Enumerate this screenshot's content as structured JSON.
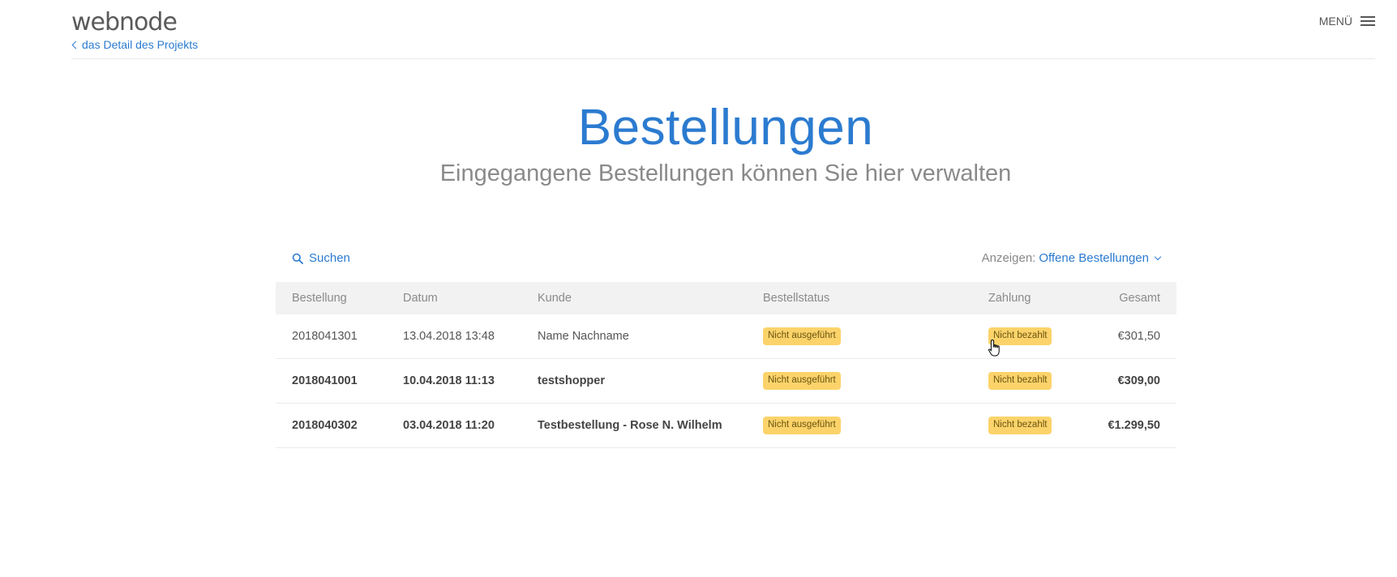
{
  "header": {
    "logo": "webnode",
    "back_link": "das Detail des Projekts",
    "menu_label": "MENÜ"
  },
  "page": {
    "title": "Bestellungen",
    "subtitle": "Eingegangene Bestellungen können Sie hier verwalten"
  },
  "toolbar": {
    "search_label": "Suchen",
    "filter_label": "Anzeigen:",
    "filter_value": "Offene Bestellungen"
  },
  "table": {
    "columns": [
      "Bestellung",
      "Datum",
      "Kunde",
      "Bestellstatus",
      "Zahlung",
      "Gesamt"
    ],
    "rows": [
      {
        "order": "2018041301",
        "date": "13.04.2018 13:48",
        "customer": "Name Nachname",
        "status": "Nicht ausgeführt",
        "payment": "Nicht bezahlt",
        "total": "€301,50"
      },
      {
        "order": "2018041001",
        "date": "10.04.2018 11:13",
        "customer": "testshopper",
        "status": "Nicht ausgeführt",
        "payment": "Nicht bezahlt",
        "total": "€309,00"
      },
      {
        "order": "2018040302",
        "date": "03.04.2018 11:20",
        "customer": "Testbestellung - Rose N. Wilhelm",
        "status": "Nicht ausgeführt",
        "payment": "Nicht bezahlt",
        "total": "€1.299,50"
      }
    ]
  },
  "icons": {
    "search": "search-icon",
    "menu": "hamburger-icon",
    "back": "chevron-left-icon",
    "dropdown": "chevron-down-icon",
    "cursor": "hand-pointer-icon"
  },
  "colors": {
    "accent": "#2b7bd0",
    "badge": "#fcd36a",
    "header_row": "#f2f2f2"
  }
}
